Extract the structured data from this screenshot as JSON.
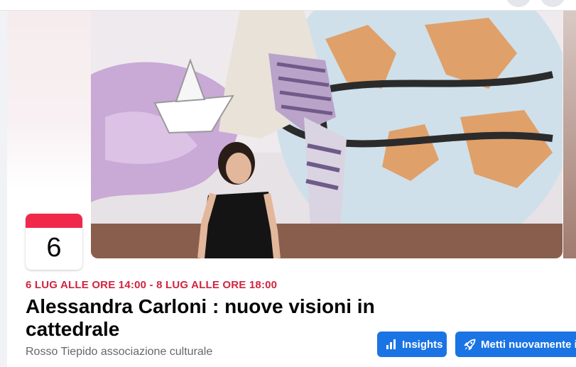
{
  "event": {
    "day": "6",
    "date_range": "6 LUG ALLE ORE 14:00 - 8 LUG ALLE ORE 18:00",
    "title": "Alessandra Carloni : nuove visioni in cattedrale",
    "organizer": "Rosso Tiepido associazione culturale"
  },
  "actions": {
    "insights_label": "Insights",
    "promote_label": "Metti nuovamente in"
  },
  "icons": {
    "insights": "bar-chart-icon",
    "promote": "rocket-icon"
  },
  "colors": {
    "accent": "#1b74e4",
    "date_red": "#d1253f",
    "badge_red": "#f0284a"
  }
}
